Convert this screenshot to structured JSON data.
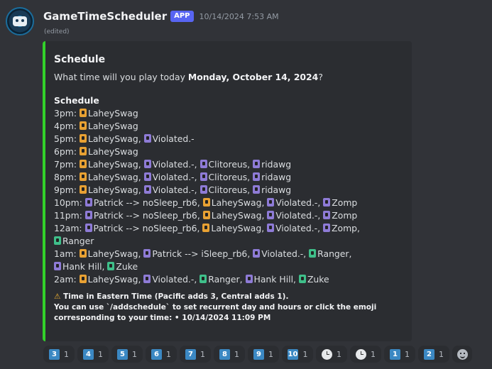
{
  "message": {
    "username": "GameTimeScheduler",
    "badge": "APP",
    "timestamp": "10/14/2024 7:53 AM",
    "edited": "(edited)",
    "avatar_icon": "game-controller-icon"
  },
  "embed": {
    "accent_color": "#33d12a",
    "title": "Schedule",
    "question_prefix": "What time will you play today",
    "question_date": "Monday, October 14, 2024",
    "question_suffix": "?",
    "schedule_title": "Schedule",
    "schedule": [
      {
        "time": "3pm:",
        "users": [
          {
            "name": "LaheySwag",
            "color": "#e8a133"
          }
        ]
      },
      {
        "time": "4pm:",
        "users": [
          {
            "name": "LaheySwag",
            "color": "#e8a133"
          }
        ]
      },
      {
        "time": "5pm:",
        "users": [
          {
            "name": "LaheySwag",
            "color": "#e8a133"
          },
          {
            "name": "Violated.-",
            "color": "#8e7bd6"
          }
        ]
      },
      {
        "time": "6pm:",
        "users": [
          {
            "name": "LaheySwag",
            "color": "#e8a133"
          }
        ]
      },
      {
        "time": "7pm:",
        "users": [
          {
            "name": "LaheySwag",
            "color": "#e8a133"
          },
          {
            "name": "Violated.-",
            "color": "#8e7bd6"
          },
          {
            "name": "Clitoreus",
            "color": "#8e7bd6"
          },
          {
            "name": "ridawg",
            "color": "#8e7bd6"
          }
        ]
      },
      {
        "time": "8pm:",
        "users": [
          {
            "name": "LaheySwag",
            "color": "#e8a133"
          },
          {
            "name": "Violated.-",
            "color": "#8e7bd6"
          },
          {
            "name": "Clitoreus",
            "color": "#8e7bd6"
          },
          {
            "name": "ridawg",
            "color": "#8e7bd6"
          }
        ]
      },
      {
        "time": "9pm:",
        "users": [
          {
            "name": "LaheySwag",
            "color": "#e8a133"
          },
          {
            "name": "Violated.-",
            "color": "#8e7bd6"
          },
          {
            "name": "Clitoreus",
            "color": "#8e7bd6"
          },
          {
            "name": "ridawg",
            "color": "#8e7bd6"
          }
        ]
      },
      {
        "time": "10pm:",
        "users": [
          {
            "name": "Patrick --> noSleep_rb6",
            "color": "#8e7bd6"
          },
          {
            "name": "LaheySwag",
            "color": "#e8a133"
          },
          {
            "name": "Violated.-",
            "color": "#8e7bd6"
          },
          {
            "name": "Zomp",
            "color": "#8e7bd6"
          }
        ]
      },
      {
        "time": "11pm:",
        "users": [
          {
            "name": "Patrick --> noSleep_rb6",
            "color": "#8e7bd6"
          },
          {
            "name": "LaheySwag",
            "color": "#e8a133"
          },
          {
            "name": "Violated.-",
            "color": "#8e7bd6"
          },
          {
            "name": "Zomp",
            "color": "#8e7bd6"
          }
        ]
      },
      {
        "time": "12am:",
        "users": [
          {
            "name": "Patrick --> noSleep_rb6",
            "color": "#8e7bd6"
          },
          {
            "name": "LaheySwag",
            "color": "#e8a133"
          },
          {
            "name": "Violated.-",
            "color": "#8e7bd6"
          },
          {
            "name": "Zomp",
            "color": "#8e7bd6"
          },
          {
            "name": "Ranger",
            "color": "#3fbf8a"
          }
        ]
      },
      {
        "time": "1am:",
        "users": [
          {
            "name": "LaheySwag",
            "color": "#e8a133"
          },
          {
            "name": "Patrick --> iSleep_rb6",
            "color": "#8e7bd6"
          },
          {
            "name": "Violated.-",
            "color": "#8e7bd6"
          },
          {
            "name": "Ranger",
            "color": "#3fbf8a"
          },
          {
            "name": "Hank Hill",
            "color": "#8e7bd6"
          },
          {
            "name": "Zuke",
            "color": "#3fbf8a"
          }
        ]
      },
      {
        "time": "2am:",
        "users": [
          {
            "name": "LaheySwag",
            "color": "#e8a133"
          },
          {
            "name": "Violated.-",
            "color": "#8e7bd6"
          },
          {
            "name": "Ranger",
            "color": "#3fbf8a"
          },
          {
            "name": "Hank Hill",
            "color": "#8e7bd6"
          },
          {
            "name": "Zuke",
            "color": "#3fbf8a"
          }
        ]
      }
    ],
    "footer_icon": "warning-icon",
    "footer_line1": "Time in Eastern Time (Pacific adds 3, Central adds 1).",
    "footer_line2": "You can use `/addschedule` to set recurrent day and hours or click the emoji corresponding to your time: • 10/14/2024 11:09 PM"
  },
  "reactions": [
    {
      "emoji": "3",
      "kind": "keycap",
      "count": "1"
    },
    {
      "emoji": "4",
      "kind": "keycap",
      "count": "1"
    },
    {
      "emoji": "5",
      "kind": "keycap",
      "count": "1"
    },
    {
      "emoji": "6",
      "kind": "keycap",
      "count": "1"
    },
    {
      "emoji": "7",
      "kind": "keycap",
      "count": "1"
    },
    {
      "emoji": "8",
      "kind": "keycap",
      "count": "1"
    },
    {
      "emoji": "9",
      "kind": "keycap",
      "count": "1"
    },
    {
      "emoji": "10",
      "kind": "keycap",
      "count": "1"
    },
    {
      "emoji": "clock-icon",
      "kind": "clock",
      "count": "1"
    },
    {
      "emoji": "clock-icon",
      "kind": "clock",
      "count": "1"
    },
    {
      "emoji": "1",
      "kind": "keycap",
      "count": "1"
    },
    {
      "emoji": "2",
      "kind": "keycap",
      "count": "1"
    }
  ],
  "add_reaction_icon": "smiley-icon"
}
